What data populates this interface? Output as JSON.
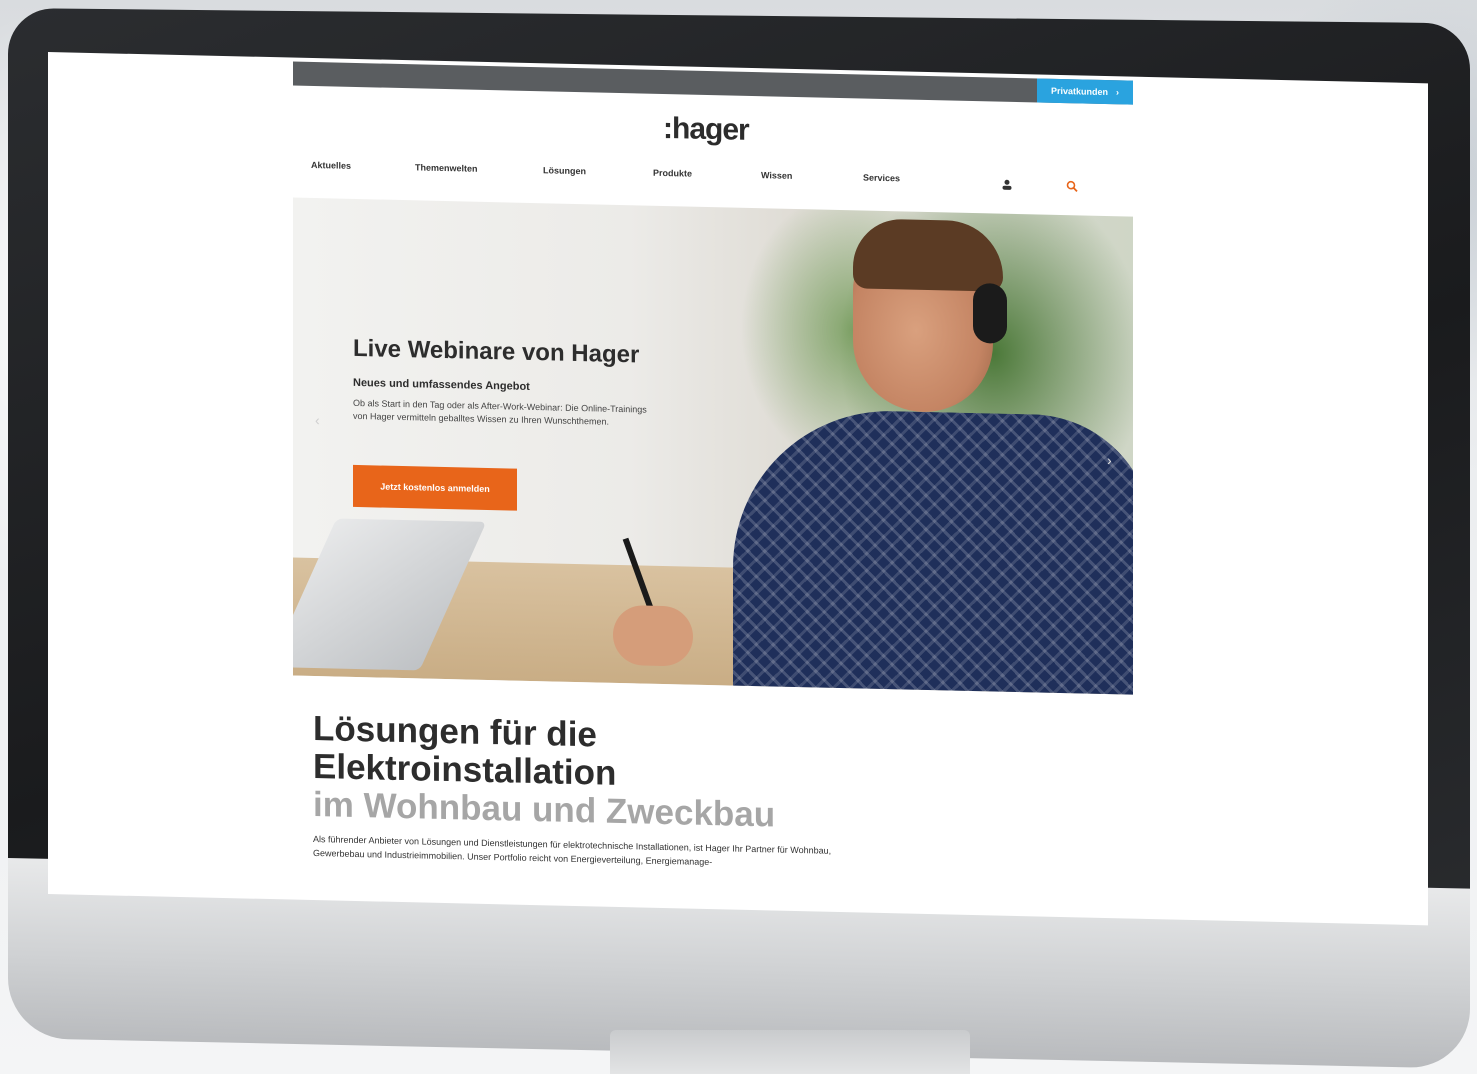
{
  "topbar": {
    "button_label": "Privatkunden",
    "button_arrow": "›"
  },
  "logo": ":hager",
  "nav": [
    {
      "label": "Aktuelles"
    },
    {
      "label": "Themenwelten"
    },
    {
      "label": "Lösungen"
    },
    {
      "label": "Produkte"
    },
    {
      "label": "Wissen"
    },
    {
      "label": "Services"
    }
  ],
  "icons": {
    "user": "user-icon",
    "search": "search-icon"
  },
  "hero": {
    "title": "Live Webinare von Hager",
    "subtitle": "Neues und umfassendes Angebot",
    "description": "Ob als Start in den Tag oder als After-Work-Webinar: Die Online-Trainings von Hager vermitteln geballtes Wissen zu Ihren Wunschthemen.",
    "button_label": "Jetzt kostenlos anmelden",
    "arrow_left": "‹",
    "arrow_right": "›"
  },
  "section": {
    "heading_line1": "Lösungen für die Elektroinstallation",
    "heading_line2": "im Wohnbau und Zweckbau",
    "body": "Als führender Anbieter von Lösungen und Dienstleistungen für elektrotechnische Installationen, ist Hager Ihr Partner für Wohnbau, Gewerbebau und Industrieimmobilien. Unser Portfolio reicht von Energieverteilung, Energiemanage-"
  },
  "colors": {
    "accent_orange": "#e8651a",
    "accent_blue": "#2aa3df",
    "topbar_gray": "#5a5d60"
  }
}
